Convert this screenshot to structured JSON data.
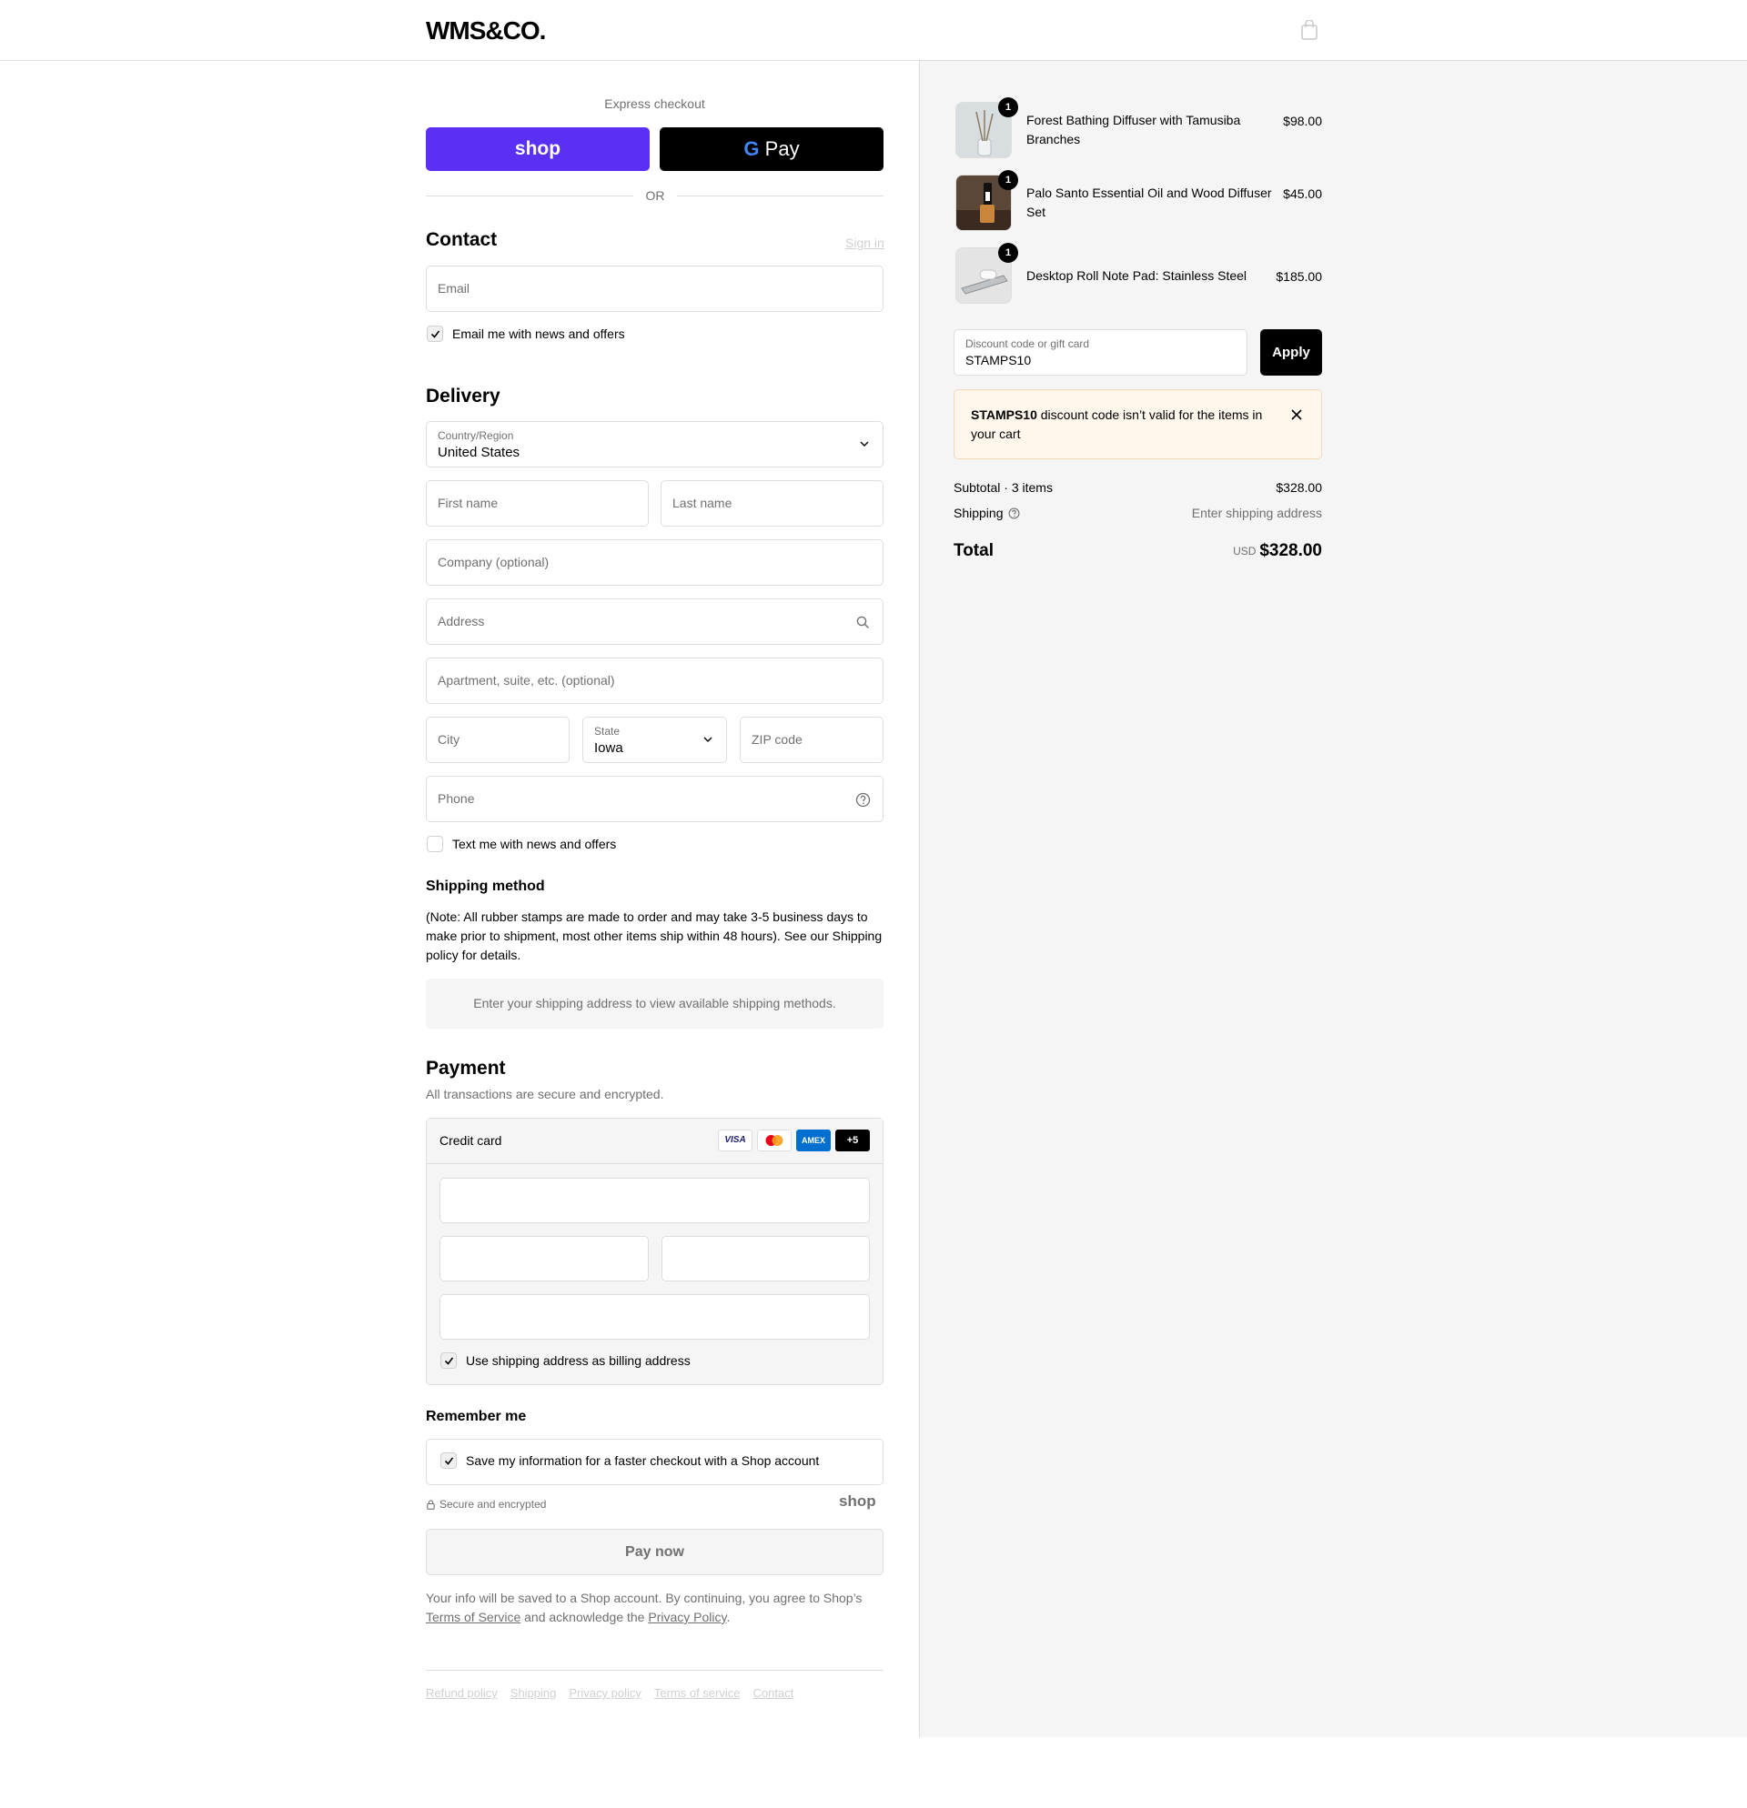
{
  "header": {
    "logo": "WMS&CO."
  },
  "express": {
    "label": "Express checkout",
    "shop_pay": "shop",
    "gpay": "Pay",
    "or": "OR"
  },
  "contact": {
    "heading": "Contact",
    "sign_in": "Sign in",
    "email_placeholder": "Email",
    "news_checkbox_label": "Email me with news and offers",
    "news_checked": true
  },
  "delivery": {
    "heading": "Delivery",
    "country_label": "Country/Region",
    "country_value": "United States",
    "first_name": "First name",
    "last_name": "Last name",
    "company": "Company (optional)",
    "address": "Address",
    "apartment": "Apartment, suite, etc. (optional)",
    "city": "City",
    "state_label": "State",
    "state_value": "Iowa",
    "zip": "ZIP code",
    "phone": "Phone",
    "text_checkbox_label": "Text me with news and offers",
    "text_checked": false
  },
  "shipping_method": {
    "heading": "Shipping method",
    "note": "(Note: All rubber stamps are made to order and may take 3-5 business days to make prior to shipment, most other items ship within 48 hours). See our Shipping policy for details.",
    "placeholder": "Enter your shipping address to view available shipping methods."
  },
  "payment": {
    "heading": "Payment",
    "subtitle": "All transactions are secure and encrypted.",
    "method": "Credit card",
    "card_logos": [
      "VISA",
      "mastercard",
      "AMEX",
      "+5"
    ],
    "billing_label": "Use shipping address as billing address",
    "billing_checked": true
  },
  "remember": {
    "heading": "Remember me",
    "save_label": "Save my information for a faster checkout with a Shop account",
    "secure_label": "Secure and encrypted",
    "shop_logo": "shop"
  },
  "pay_button": "Pay now",
  "legal": {
    "text1": "Your info will be saved to a Shop account. By continuing, you agree to Shop’s",
    "terms_link": "Terms of Service",
    "text2": "and acknowledge the",
    "privacy_link": "Privacy Policy",
    "text3": "."
  },
  "footer_links": [
    "Refund policy",
    "Shipping",
    "Privacy policy",
    "Terms of service",
    "Contact"
  ],
  "cart": {
    "items": [
      {
        "name_line1": "Forest Bathing Diffuser with Tamusiba",
        "name_line2": "Branches",
        "price": "$98.00",
        "qty": "1",
        "icon": "reed-diffuser-icon"
      },
      {
        "name_line1": "Palo Santo Essential Oil and Wood Diffuser",
        "name_line2": "Set",
        "price": "$45.00",
        "qty": "1",
        "icon": "oil-bottle-icon"
      },
      {
        "name_line1": "Desktop Roll Note Pad: Stainless Steel",
        "name_line2": "",
        "price": "$185.00",
        "qty": "1",
        "icon": "note-pad-icon"
      }
    ],
    "discount_label": "Discount code or gift card",
    "discount_value": "STAMPS10",
    "apply": "Apply",
    "error_code": "STAMPS10",
    "error_text_1": "discount code isn’t valid for the items in",
    "error_text_2": "your cart",
    "subtotal_label": "Subtotal · 3 items",
    "subtotal_value": "$328.00",
    "shipping_label": "Shipping",
    "shipping_value": "Enter shipping address",
    "total_label": "Total",
    "currency": "USD",
    "total_value": "$328.00"
  },
  "colors": {
    "shop_purple": "#5a31f4",
    "error_bg": "#fff6ec",
    "accent": "#000000"
  }
}
